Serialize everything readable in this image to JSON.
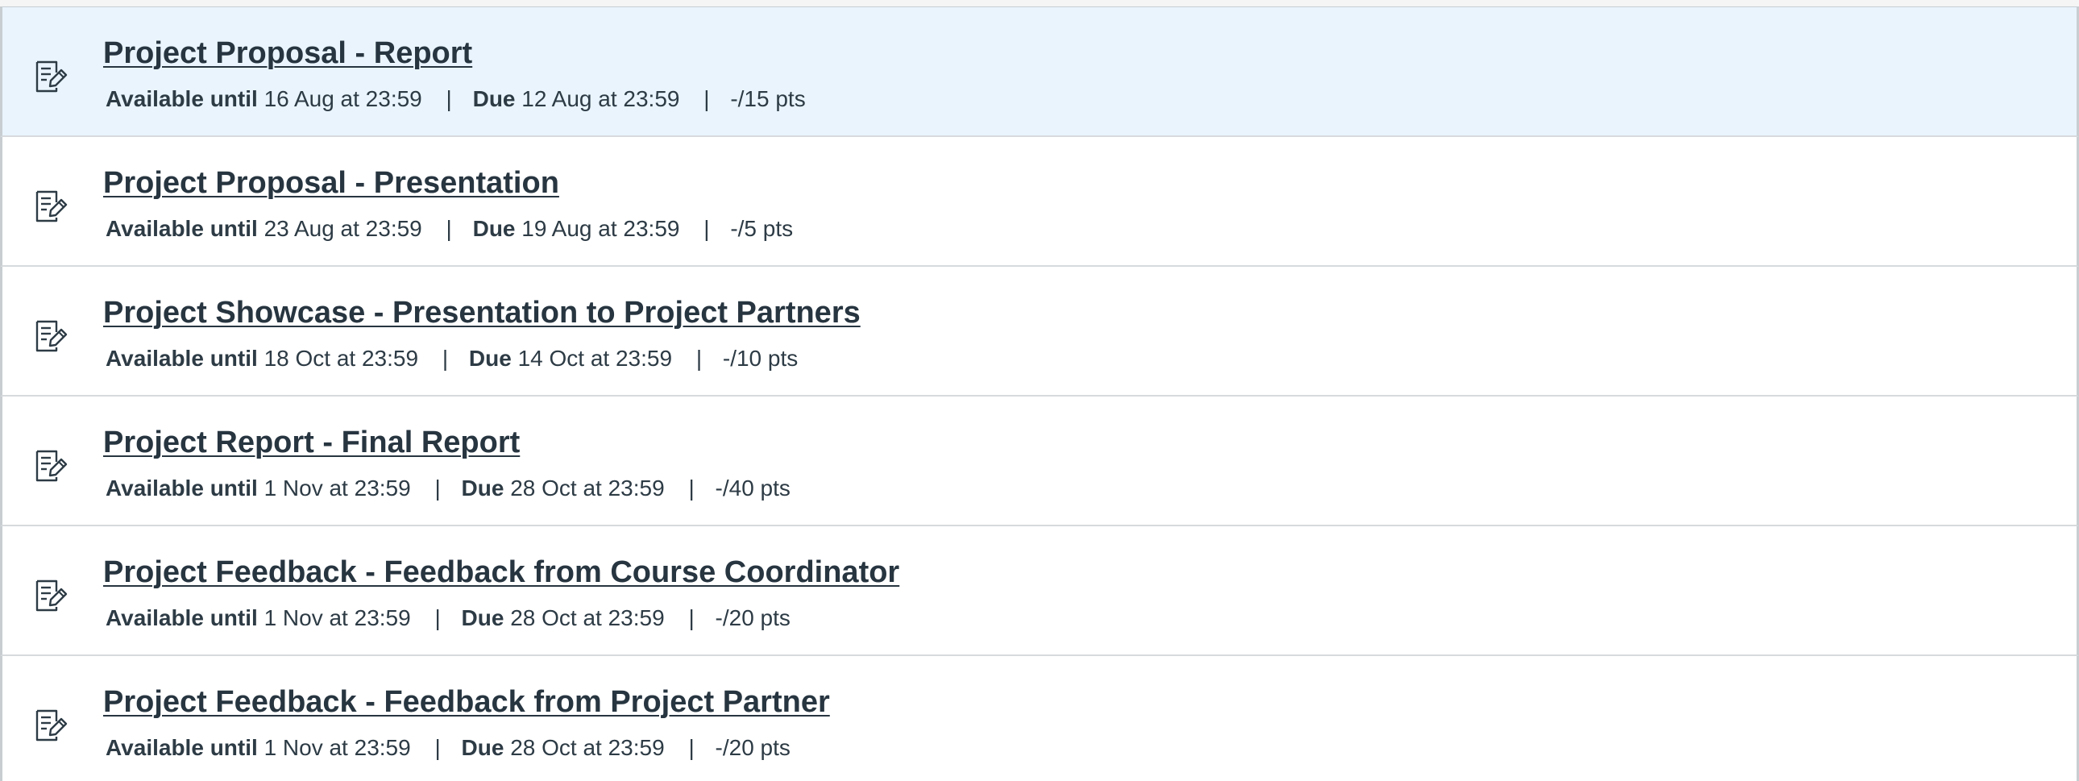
{
  "assignments": [
    {
      "title": "Project Proposal - Report",
      "available_label": "Available until",
      "available_value": "16 Aug at 23:59",
      "due_label": "Due",
      "due_value": "12 Aug at 23:59",
      "points": "-/15 pts",
      "icon": "assignment-icon",
      "selected": true
    },
    {
      "title": "Project Proposal - Presentation",
      "available_label": "Available until",
      "available_value": "23 Aug at 23:59",
      "due_label": "Due",
      "due_value": "19 Aug at 23:59",
      "points": "-/5 pts",
      "icon": "assignment-icon",
      "selected": false
    },
    {
      "title": "Project Showcase - Presentation to Project Partners",
      "available_label": "Available until",
      "available_value": "18 Oct at 23:59",
      "due_label": "Due",
      "due_value": "14 Oct at 23:59",
      "points": "-/10 pts",
      "icon": "assignment-icon",
      "selected": false
    },
    {
      "title": "Project Report - Final Report",
      "available_label": "Available until",
      "available_value": "1 Nov at 23:59",
      "due_label": "Due",
      "due_value": "28 Oct at 23:59",
      "points": "-/40 pts",
      "icon": "assignment-icon",
      "selected": false
    },
    {
      "title": "Project Feedback - Feedback from Course Coordinator",
      "available_label": "Available until",
      "available_value": "1 Nov at 23:59",
      "due_label": "Due",
      "due_value": "28 Oct at 23:59",
      "points": "-/20 pts",
      "icon": "assignment-icon",
      "selected": false
    },
    {
      "title": "Project Feedback - Feedback from Project Partner",
      "available_label": "Available until",
      "available_value": "1 Nov at 23:59",
      "due_label": "Due",
      "due_value": "28 Oct at 23:59",
      "points": "-/20 pts",
      "icon": "assignment-icon",
      "selected": false
    }
  ],
  "separator": "|",
  "colors": {
    "selected_row": "#e9f4fd",
    "text": "#2d3b45",
    "title": "#273540",
    "border": "#c7cdd1"
  }
}
